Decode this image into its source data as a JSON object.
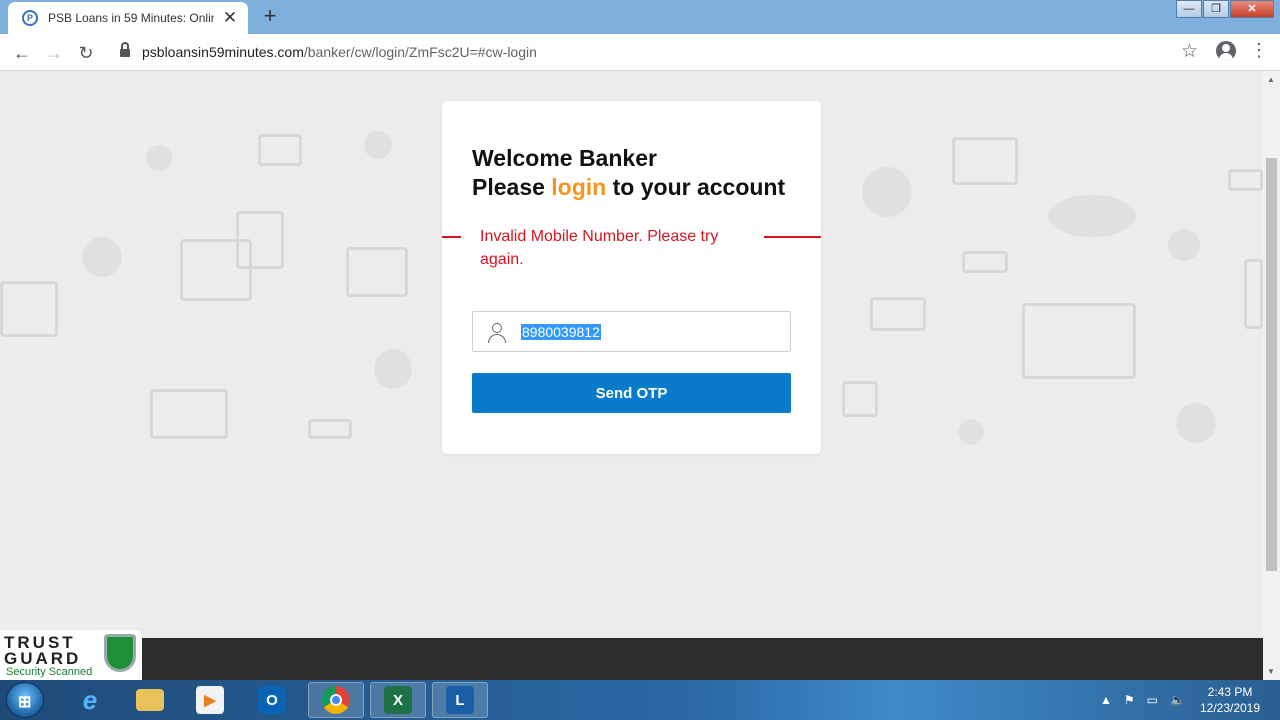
{
  "browser": {
    "tab_title": "PSB Loans in 59 Minutes: Online",
    "tab_close": "✕",
    "new_tab": "+",
    "url_host": "psbloansin59minutes.com",
    "url_path": "/banker/cw/login/ZmFsc2U=#cw-login"
  },
  "card": {
    "heading_line1": "Welcome Banker",
    "heading_line2_prefix": "Please ",
    "heading_line2_accent": "login",
    "heading_line2_suffix": " to your account",
    "error_message": "Invalid Mobile Number. Please try again.",
    "mobile_value": "8980039812",
    "send_button": "Send OTP"
  },
  "trustguard": {
    "line1": "TRUST",
    "line2": "GUARD",
    "scanned": "Security Scanned"
  },
  "taskbar": {
    "apps": [
      "internet-explorer",
      "file-explorer",
      "media-player",
      "outlook",
      "chrome",
      "excel",
      "lync"
    ],
    "time": "2:43 PM",
    "date": "12/23/2019"
  },
  "colors": {
    "accent_orange": "#f7941d",
    "error_red": "#d9141e",
    "button_blue": "#0a7acb"
  }
}
